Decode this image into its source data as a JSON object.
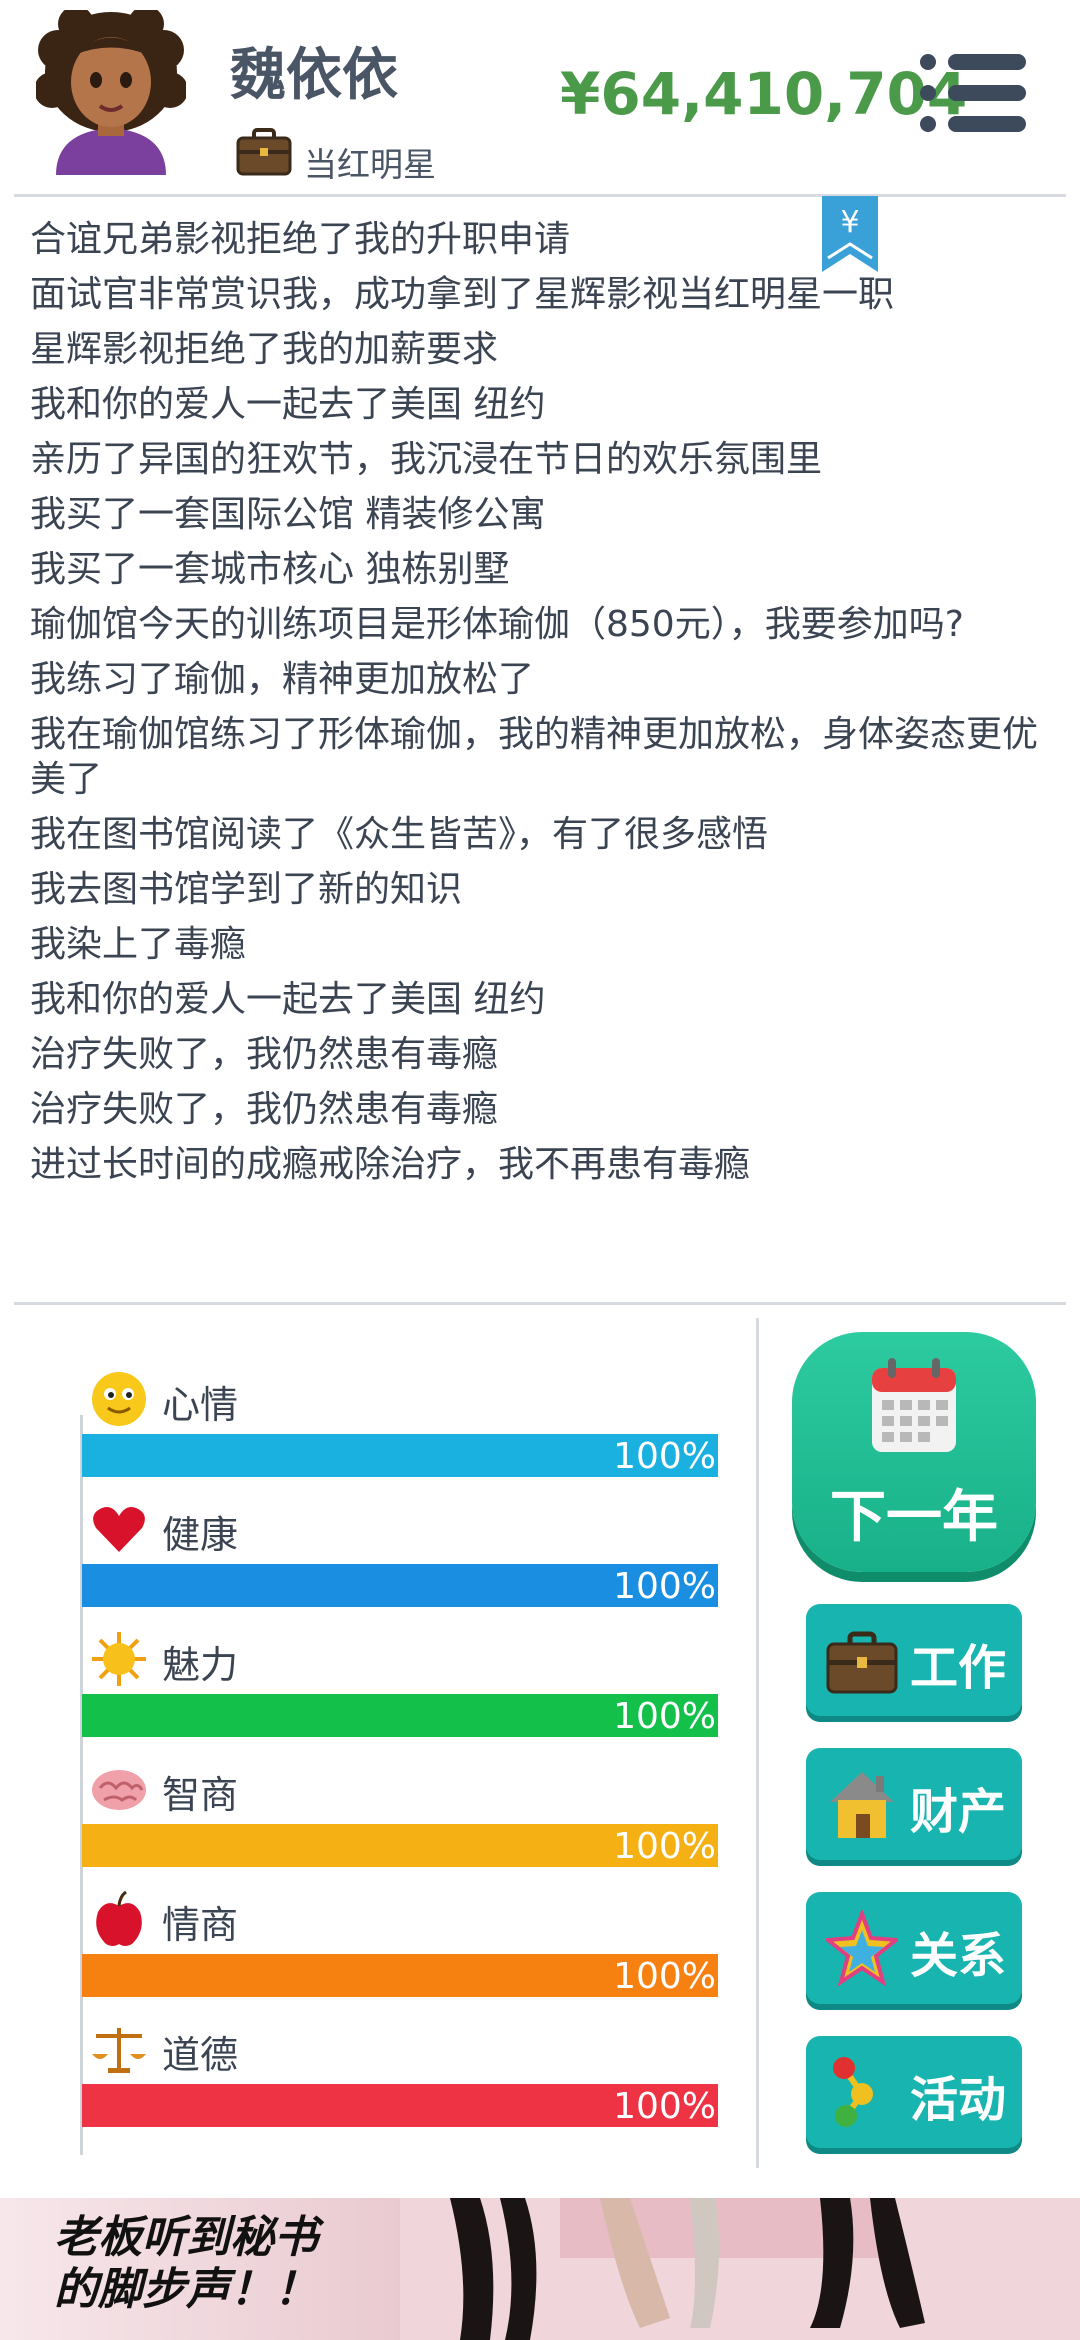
{
  "header": {
    "name": "魏依依",
    "job": "当红明星",
    "money": "¥64,410,704",
    "bookmark_label": "¥"
  },
  "log": [
    "合谊兄弟影视拒绝了我的升职申请",
    "面试官非常赏识我，成功拿到了星辉影视当红明星一职",
    "星辉影视拒绝了我的加薪要求",
    "我和你的爱人一起去了美国 纽约",
    "亲历了异国的狂欢节，我沉浸在节日的欢乐氛围里",
    "我买了一套国际公馆 精装修公寓",
    "我买了一套城市核心 独栋别墅",
    "瑜伽馆今天的训练项目是形体瑜伽（850元），我要参加吗?",
    "我练习了瑜伽，精神更加放松了",
    "我在瑜伽馆练习了形体瑜伽，我的精神更加放松，身体姿态更优美了",
    "我在图书馆阅读了《众生皆苦》，有了很多感悟",
    "我去图书馆学到了新的知识",
    "我染上了毒瘾",
    "我和你的爱人一起去了美国 纽约",
    "治疗失败了，我仍然患有毒瘾",
    "治疗失败了，我仍然患有毒瘾",
    "进过长时间的成瘾戒除治疗，我不再患有毒瘾"
  ],
  "stats": [
    {
      "label": "心情",
      "value_text": "100%",
      "value": 1.0,
      "color": "#1ab0e0",
      "icon": "smiley-icon"
    },
    {
      "label": "健康",
      "value_text": "100%",
      "value": 1.0,
      "color": "#1a8ee0",
      "icon": "heart-icon"
    },
    {
      "label": "魅力",
      "value_text": "100%",
      "value": 1.0,
      "color": "#12c04a",
      "icon": "sun-icon"
    },
    {
      "label": "智商",
      "value_text": "100%",
      "value": 1.0,
      "color": "#f5b014",
      "icon": "brain-icon"
    },
    {
      "label": "情商",
      "value_text": "100%",
      "value": 1.0,
      "color": "#f78110",
      "icon": "apple-icon"
    },
    {
      "label": "道德",
      "value_text": "100%",
      "value": 1.0,
      "color": "#ee3344",
      "icon": "scales-icon"
    }
  ],
  "actions": {
    "next_year": "下一年",
    "work": "工作",
    "property": "财产",
    "relations": "关系",
    "activities": "活动"
  },
  "ad": {
    "line1": "老板听到秘书",
    "line2": "的脚步声！！"
  }
}
